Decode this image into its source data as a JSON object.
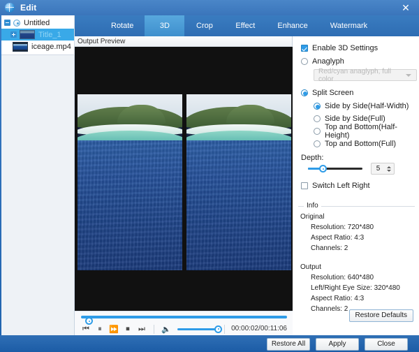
{
  "window": {
    "title": "Edit",
    "icon": "globe-icon",
    "close_label": "✕"
  },
  "sidebar": {
    "tree": [
      {
        "label": "Untitled",
        "level": 0,
        "selected": false,
        "icon": "disc-icon",
        "expander": "minus"
      },
      {
        "label": "Title_1",
        "level": 1,
        "selected": true,
        "icon": "video-thumb-icon",
        "expander": "plus"
      },
      {
        "label": "iceage.mp4",
        "level": 2,
        "selected": false,
        "icon": "file-thumb-icon",
        "expander": "none"
      }
    ]
  },
  "tabs": [
    {
      "label": "Rotate",
      "active": false
    },
    {
      "label": "3D",
      "active": true
    },
    {
      "label": "Crop",
      "active": false
    },
    {
      "label": "Effect",
      "active": false
    },
    {
      "label": "Enhance",
      "active": false
    },
    {
      "label": "Watermark",
      "active": false
    }
  ],
  "preview": {
    "header": "Output Preview",
    "split_mode": "side-by-side"
  },
  "player": {
    "seek_percent": 2,
    "volume_percent": 100,
    "timecode": "00:00:02/00:11:06",
    "buttons": [
      {
        "name": "previous-button",
        "glyph": "⏮"
      },
      {
        "name": "pause-button",
        "glyph": "⏸"
      },
      {
        "name": "fast-forward-button",
        "glyph": "⏩"
      },
      {
        "name": "stop-button",
        "glyph": "⏹"
      },
      {
        "name": "next-button",
        "glyph": "⏭"
      }
    ],
    "volume_icon": "🔈"
  },
  "settings": {
    "enable_3d": {
      "label": "Enable 3D Settings",
      "checked": true
    },
    "anaglyph": {
      "label": "Anaglyph",
      "selected": false
    },
    "anaglyph_combo": {
      "value": "Red/cyan anaglyph, full color",
      "enabled": false
    },
    "split_screen": {
      "label": "Split Screen",
      "selected": true
    },
    "split_options": [
      {
        "label": "Side by Side(Half-Width)",
        "selected": true
      },
      {
        "label": "Side by Side(Full)",
        "selected": false
      },
      {
        "label": "Top and Bottom(Half-Height)",
        "selected": false
      },
      {
        "label": "Top and Bottom(Full)",
        "selected": false
      }
    ],
    "depth": {
      "label": "Depth:",
      "value": "5",
      "slider_percent": 25
    },
    "switch_left_right": {
      "label": "Switch Left Right",
      "checked": false
    },
    "restore_defaults_label": "Restore Defaults"
  },
  "info": {
    "legend": "Info",
    "original_heading": "Original",
    "original": [
      "Resolution: 720*480",
      "Aspect Ratio: 4:3",
      "Channels: 2"
    ],
    "output_heading": "Output",
    "output": [
      "Resolution: 640*480",
      "Left/Right Eye Size: 320*480",
      "Aspect Ratio: 4:3",
      "Channels: 2"
    ]
  },
  "footer": {
    "restore_all": "Restore All",
    "apply": "Apply",
    "close": "Close"
  },
  "colors": {
    "accent": "#2f9ce8",
    "chrome": "#2e6db3",
    "tab_active": "#58a8de"
  }
}
